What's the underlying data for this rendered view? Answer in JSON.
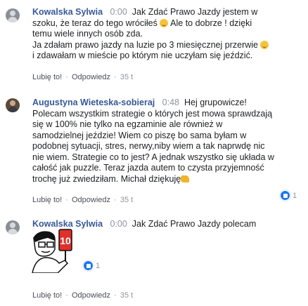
{
  "comments": [
    {
      "author": "Kowalska Sylwia",
      "time": "0:00",
      "reference": "Jak Zdać Prawo Jazdy",
      "line1_rest": "jestem w",
      "line2": "szoku, że teraz do tego wróciłeś",
      "line2_rest": "Ale to dobrze ! dzięki",
      "line3": "temu wiele innych osób zda.",
      "line4": "Ja zdałam prawo jazdy na luzie po 3 miesięcznej przerwie",
      "line5": "i zdawałam w mieście po którym nie uczyłam się jeździć.",
      "like": "Lubię to!",
      "reply": "Odpowiedz",
      "age": "35 t"
    },
    {
      "author": "Augustyna Wieteska-sobieraj",
      "time": "0:48",
      "line1_rest": "Hej grupowicze!",
      "lines": [
        "Polecam wszystkim strategie o których jest mowa sprawdzają",
        "się w 100% nie tylko na egzaminie ale również w",
        "samodzielnej jeździe! Wiem co piszę bo sama byłam w",
        "podobnej sytuacji, stres, nerwy,niby wiem a tak naprwdę nic",
        "nie wiem. Strategie co to jest? A jednak wszystko się układa w",
        "całość jak puzzle. Teraz jazda autem to czysta przyjemność",
        "trochę już zwiedziłam. Michał dziękuję"
      ],
      "like": "Lubię to!",
      "reply": "Odpowiedz",
      "age": "35 t",
      "reactions": "1"
    },
    {
      "author": "Kowalska Sylwia",
      "time": "0:00",
      "reference": "Jak Zdać Prawo Jazdy",
      "line1_rest": "polecam",
      "sticker_sign": "10",
      "reactions": "1",
      "like": "Lubię to!",
      "reply": "Odpowiedz",
      "age": "35 t"
    }
  ],
  "colors": {
    "link": "#385898",
    "meta": "#90949c",
    "like": "#1877f2",
    "sign": "#e0302a"
  },
  "icons": [
    "avatar-icon",
    "grinning-emoji-icon",
    "smile-emoji-icon",
    "clap-emoji-icon",
    "like-reaction-icon",
    "sticker-icon"
  ]
}
